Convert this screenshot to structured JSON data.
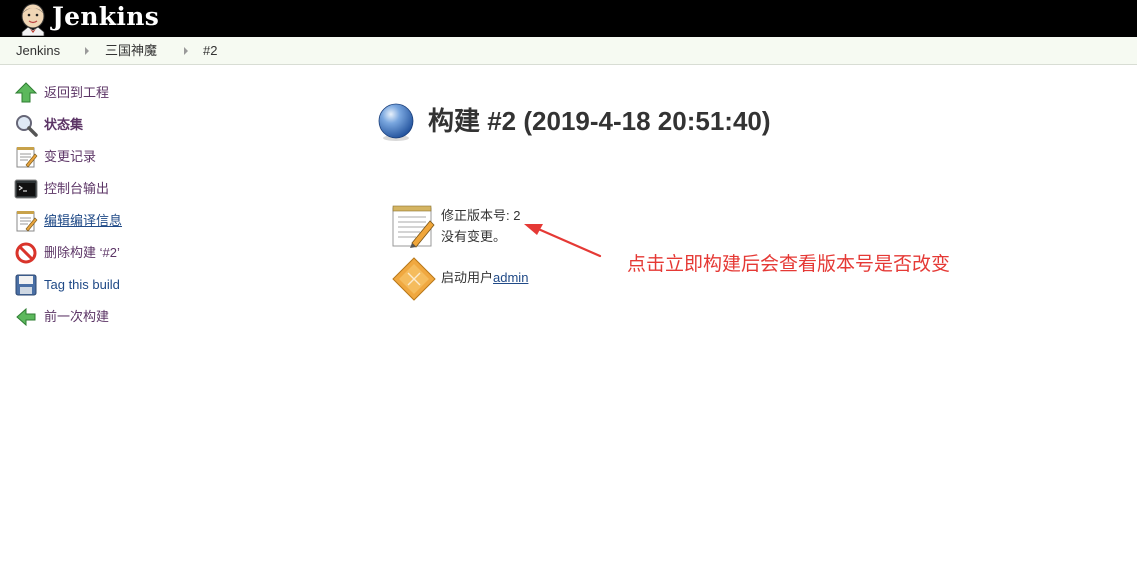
{
  "header": {
    "brand": "Jenkins",
    "logo_icon": "jenkins-butler-icon"
  },
  "breadcrumb": {
    "items": [
      "Jenkins",
      "三国神魔",
      "#2"
    ]
  },
  "sidebar": {
    "items": [
      {
        "label": "返回到工程",
        "icon": "up-arrow-icon"
      },
      {
        "label": "状态集",
        "icon": "magnifier-icon"
      },
      {
        "label": "变更记录",
        "icon": "notepad-icon"
      },
      {
        "label": "控制台输出",
        "icon": "terminal-icon"
      },
      {
        "label": "编辑编译信息",
        "icon": "notepad-edit-icon"
      },
      {
        "label": "删除构建 ‘#2’",
        "icon": "no-entry-icon"
      },
      {
        "label": "Tag this build",
        "icon": "save-icon"
      },
      {
        "label": "前一次构建",
        "icon": "left-arrow-icon"
      }
    ]
  },
  "main": {
    "title": "构建 #2 (2019-4-18 20:51:40)",
    "status_icon": "blue-ball-icon",
    "revision_label": "修正版本号: 2",
    "no_changes": "没有变更。",
    "started_by_prefix": "启动用户",
    "started_by_user": "admin"
  },
  "annotation": {
    "text": "点击立即构建后会查看版本号是否改变",
    "color": "#e53935"
  },
  "colors": {
    "header_bg": "#000000",
    "breadcrumb_bg": "#f6faf2",
    "link": "#204a87",
    "visited_link": "#5c3566"
  }
}
